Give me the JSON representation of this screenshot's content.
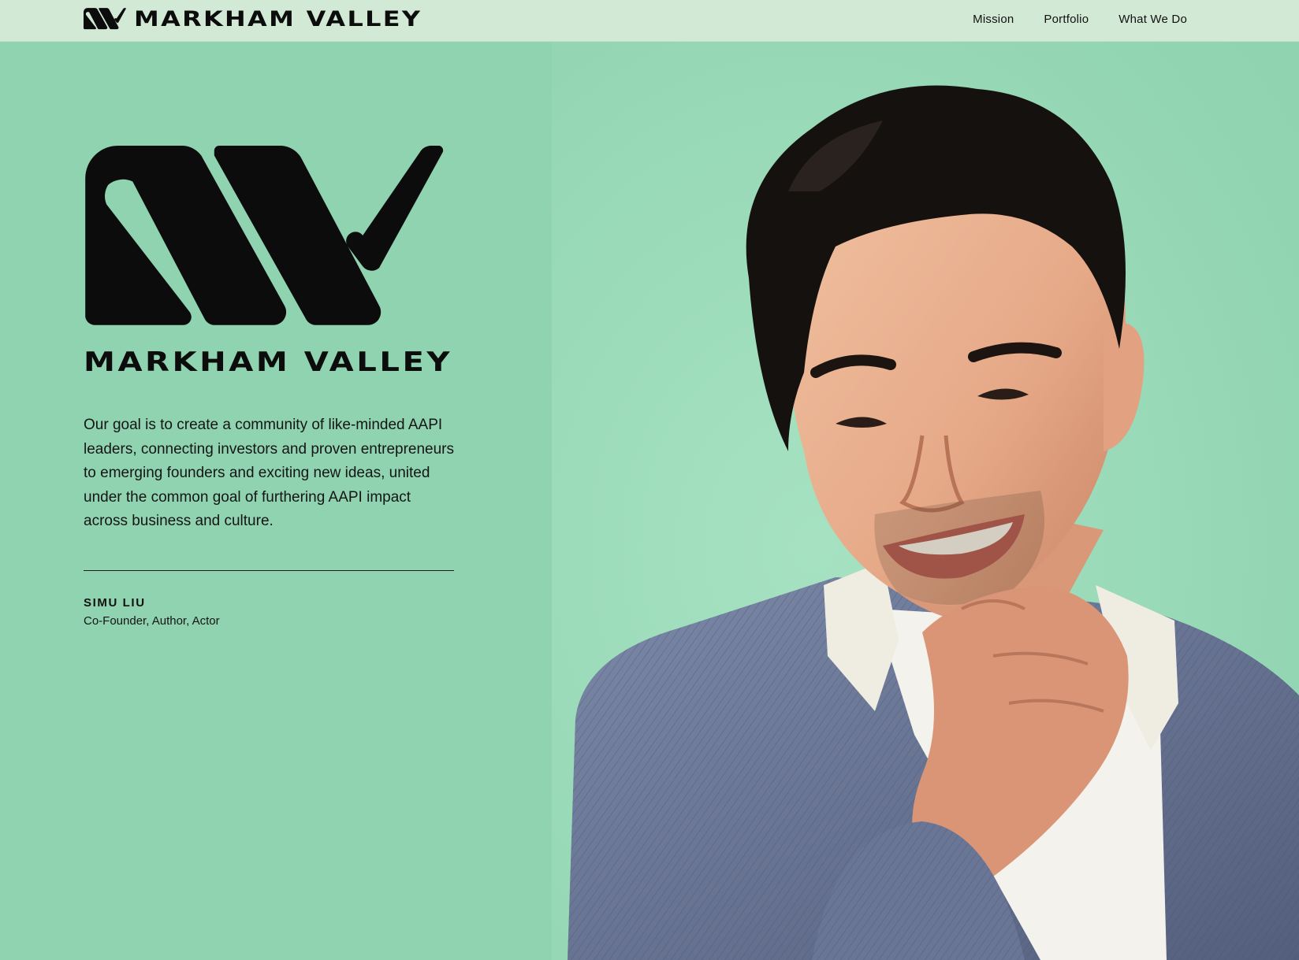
{
  "brand": {
    "name": "MARKHAM  VALLEY",
    "logo_icon": "mv-monogram-icon",
    "logo_text": "MARKHAM  VALLEY"
  },
  "nav": {
    "items": [
      {
        "label": "Mission"
      },
      {
        "label": "Portfolio"
      },
      {
        "label": "What We Do"
      }
    ]
  },
  "hero": {
    "logo_text": "MARKHAM  VALLEY",
    "statement": "Our goal is to create a community of like-minded AAPI leaders, connecting investors and proven entrepreneurs to emerging founders and exciting new ideas, united under the common goal of furthering AAPI impact across business and culture.",
    "author": {
      "name": "SIMU LIU",
      "role": "Co-Founder, Author, Actor"
    },
    "photo": "portrait-photo"
  },
  "colors": {
    "background": "#8fd3b0",
    "topbar": "#d2ead5",
    "ink": "#0c0c0c"
  }
}
